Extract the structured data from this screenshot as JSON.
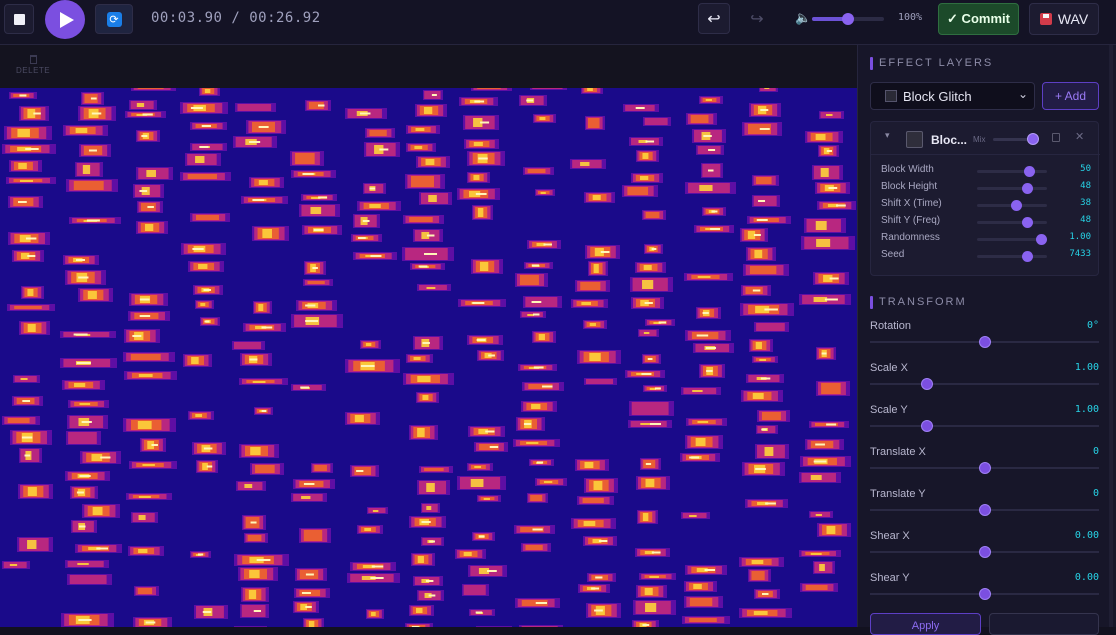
{
  "toolbar": {
    "time_display": "00:03.90 / 00:26.92",
    "volume_percent_label": "100%",
    "volume_level": 0.5,
    "commit_label": "✓ Commit",
    "export_label": "WAV",
    "undo_icon": "undo-icon",
    "redo_icon": "redo-icon"
  },
  "canvas": {
    "delete_label": "DELETE",
    "colormap": [
      "#1a0a8a",
      "#6b0fa8",
      "#c22a7c",
      "#f0662a",
      "#fdd33a",
      "#fff6b8"
    ]
  },
  "effect_layers": {
    "title": "EFFECT LAYERS",
    "selected_effect": "Block Glitch",
    "add_label": "+ Add",
    "layer": {
      "name": "Bloc...",
      "mix_label": "Mix",
      "mix_level": 0.9,
      "params": [
        {
          "label": "Block Width",
          "value": "50",
          "level": 0.75
        },
        {
          "label": "Block Height",
          "value": "48",
          "level": 0.72
        },
        {
          "label": "Shift X (Time)",
          "value": "38",
          "level": 0.57
        },
        {
          "label": "Shift Y (Freq)",
          "value": "48",
          "level": 0.72
        },
        {
          "label": "Randomness",
          "value": "1.00",
          "level": 0.92
        },
        {
          "label": "Seed",
          "value": "7433",
          "level": 0.72
        }
      ]
    }
  },
  "transform": {
    "title": "TRANSFORM",
    "rows": [
      {
        "label": "Rotation",
        "value": "0°",
        "level": 0.5
      },
      {
        "label": "Scale X",
        "value": "1.00",
        "level": 0.25
      },
      {
        "label": "Scale Y",
        "value": "1.00",
        "level": 0.25
      },
      {
        "label": "Translate X",
        "value": "0",
        "level": 0.5
      },
      {
        "label": "Translate Y",
        "value": "0",
        "level": 0.5
      },
      {
        "label": "Shear X",
        "value": "0.00",
        "level": 0.5
      },
      {
        "label": "Shear Y",
        "value": "0.00",
        "level": 0.5
      }
    ],
    "apply_label": "Apply"
  },
  "colors": {
    "accent": "#7b4fe0",
    "value_text": "#27d3e6",
    "commit_bg": "#1c4a2a"
  }
}
